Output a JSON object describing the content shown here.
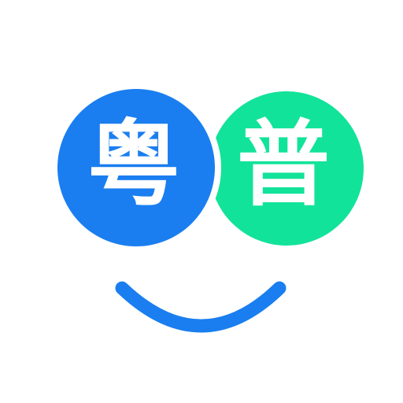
{
  "logo": {
    "left_character": "粤",
    "right_character": "普",
    "colors": {
      "background": "#ffffff",
      "left_circle": "#1a7ef0",
      "right_circle": "#12e39a",
      "smile": "#1a7ef0",
      "character": "#ffffff",
      "overlap_gap": "#ffffff"
    },
    "icons": {
      "left_circle": "blue-circle-icon",
      "right_circle": "green-circle-icon",
      "smile": "smile-curve-icon"
    }
  }
}
